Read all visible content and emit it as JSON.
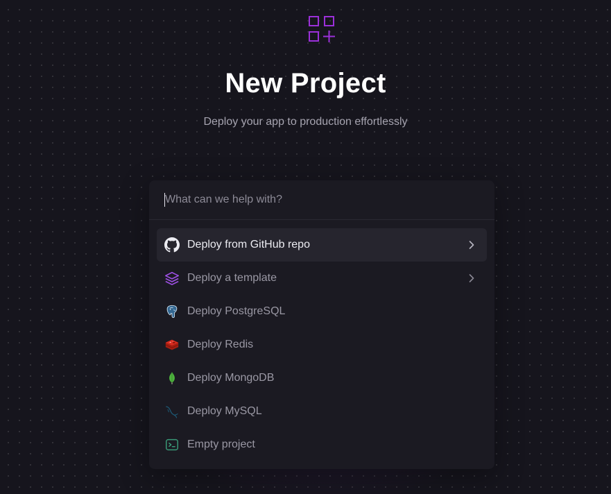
{
  "header": {
    "logo_icon": "grid-plus-icon",
    "title": "New Project",
    "subtitle": "Deploy your app to production effortlessly"
  },
  "search": {
    "placeholder": "What can we help with?",
    "value": ""
  },
  "options": [
    {
      "label": "Deploy from GitHub repo",
      "icon": "github-icon",
      "has_chevron": true,
      "active": true
    },
    {
      "label": "Deploy a template",
      "icon": "layers-icon",
      "has_chevron": true,
      "active": false
    },
    {
      "label": "Deploy PostgreSQL",
      "icon": "postgresql-icon",
      "has_chevron": false,
      "active": false
    },
    {
      "label": "Deploy Redis",
      "icon": "redis-icon",
      "has_chevron": false,
      "active": false
    },
    {
      "label": "Deploy MongoDB",
      "icon": "mongodb-icon",
      "has_chevron": false,
      "active": false
    },
    {
      "label": "Deploy MySQL",
      "icon": "mysql-icon",
      "has_chevron": false,
      "active": false
    },
    {
      "label": "Empty project",
      "icon": "terminal-icon",
      "has_chevron": false,
      "active": false
    }
  ],
  "colors": {
    "background": "#16151d",
    "panel": "#1b1a22",
    "accent": "#9b30d9",
    "active_row": "#26252e"
  }
}
